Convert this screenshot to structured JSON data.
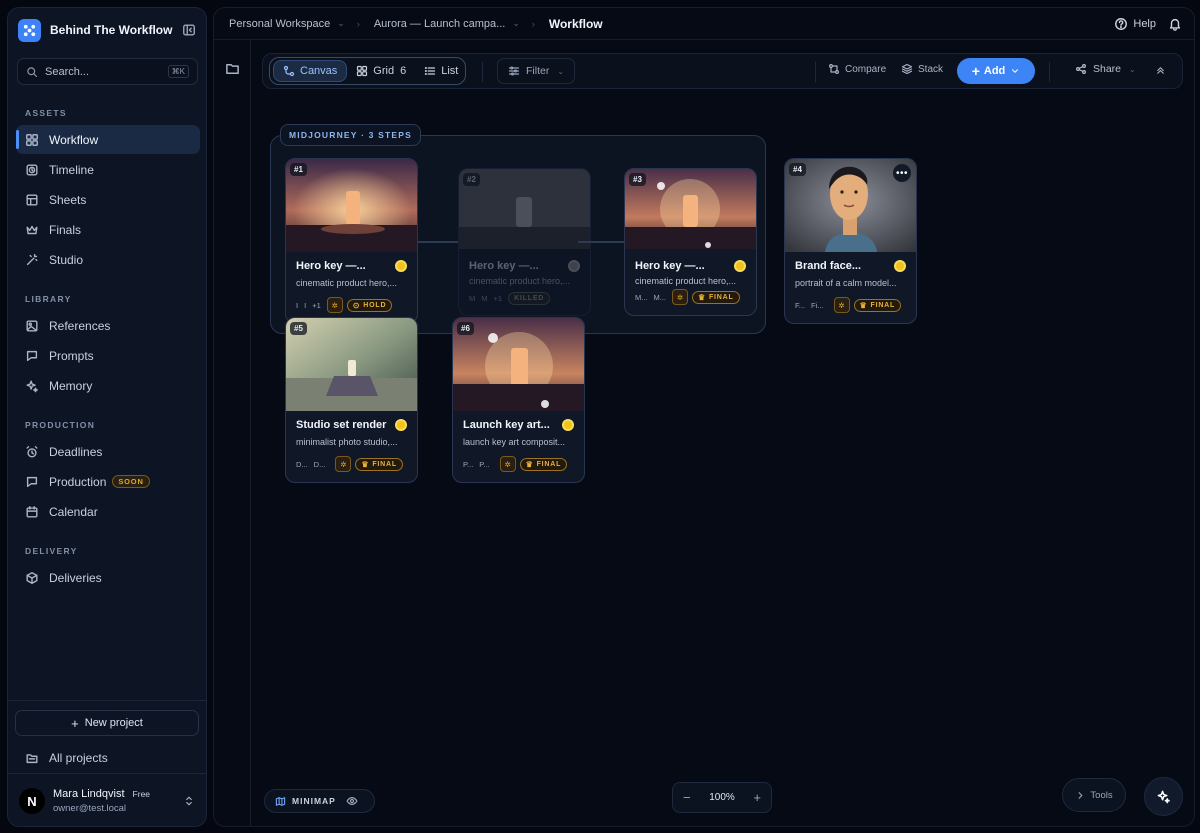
{
  "app": {
    "name": "Behind The Workflow",
    "search_placeholder": "Search...",
    "search_shortcut": "⌘K"
  },
  "sidebar": {
    "sections": [
      {
        "label": "ASSETS",
        "items": [
          {
            "label": "Workflow",
            "icon": "grid-icon",
            "active": true
          },
          {
            "label": "Timeline",
            "icon": "clock-icon"
          },
          {
            "label": "Sheets",
            "icon": "table-icon"
          },
          {
            "label": "Finals",
            "icon": "crown-icon"
          },
          {
            "label": "Studio",
            "icon": "wand-icon"
          }
        ]
      },
      {
        "label": "LIBRARY",
        "items": [
          {
            "label": "References",
            "icon": "image-icon"
          },
          {
            "label": "Prompts",
            "icon": "chat-icon"
          },
          {
            "label": "Memory",
            "icon": "sparkle-icon"
          }
        ]
      },
      {
        "label": "PRODUCTION",
        "items": [
          {
            "label": "Deadlines",
            "icon": "alarm-icon"
          },
          {
            "label": "Production",
            "icon": "chat-icon",
            "badge": "SOON"
          },
          {
            "label": "Calendar",
            "icon": "calendar-icon"
          }
        ]
      },
      {
        "label": "DELIVERY",
        "items": [
          {
            "label": "Deliveries",
            "icon": "package-icon"
          }
        ]
      }
    ],
    "new_project": "New project",
    "all_projects": "All projects",
    "user": {
      "initial": "N",
      "name": "Mara Lindqvist",
      "plan": "Free",
      "email": "owner@test.local"
    }
  },
  "breadcrumb": {
    "workspace": "Personal Workspace",
    "project": "Aurora — Launch campa...",
    "current": "Workflow"
  },
  "header": {
    "help": "Help"
  },
  "toolbar": {
    "views": [
      {
        "label": "Canvas",
        "active": true
      },
      {
        "label": "Grid",
        "count": "6"
      },
      {
        "label": "List"
      }
    ],
    "filter": "Filter",
    "compare": "Compare",
    "stack": "Stack",
    "add": "Add",
    "share": "Share"
  },
  "canvas": {
    "group_label": "MIDJOURNEY · 3 STEPS",
    "cards": [
      {
        "badge": "#1",
        "title": "Hero key —...",
        "desc": "cinematic product hero,...",
        "meta": [
          "I",
          "I",
          "+1"
        ],
        "status": "HOLD",
        "faded": false
      },
      {
        "badge": "#2",
        "title": "Hero key —...",
        "desc": "cinematic product hero,...",
        "meta": [
          "M",
          "M",
          "+1"
        ],
        "status": "KILLED",
        "faded": true
      },
      {
        "badge": "#3",
        "title": "Hero key —...",
        "desc": "cinematic product hero,...",
        "meta": [
          "M...",
          "M..."
        ],
        "status": "FINAL",
        "faded": false
      },
      {
        "badge": "#4",
        "title": "Brand face...",
        "desc": "portrait of a calm model...",
        "meta": [
          "F...",
          "Fi..."
        ],
        "status": "FINAL",
        "faded": false
      },
      {
        "badge": "#5",
        "title": "Studio set render",
        "desc": "minimalist photo studio,...",
        "meta": [
          "D...",
          "D..."
        ],
        "status": "FINAL",
        "faded": false
      },
      {
        "badge": "#6",
        "title": "Launch key art...",
        "desc": "launch key art composit...",
        "meta": [
          "P...",
          "P..."
        ],
        "status": "FINAL",
        "faded": false
      }
    ]
  },
  "footer": {
    "minimap": "MINIMAP",
    "zoom": "100%",
    "tools": "Tools"
  },
  "colors": {
    "accent": "#3d84f7",
    "final": "#e6b23a",
    "background": "#060a14"
  }
}
